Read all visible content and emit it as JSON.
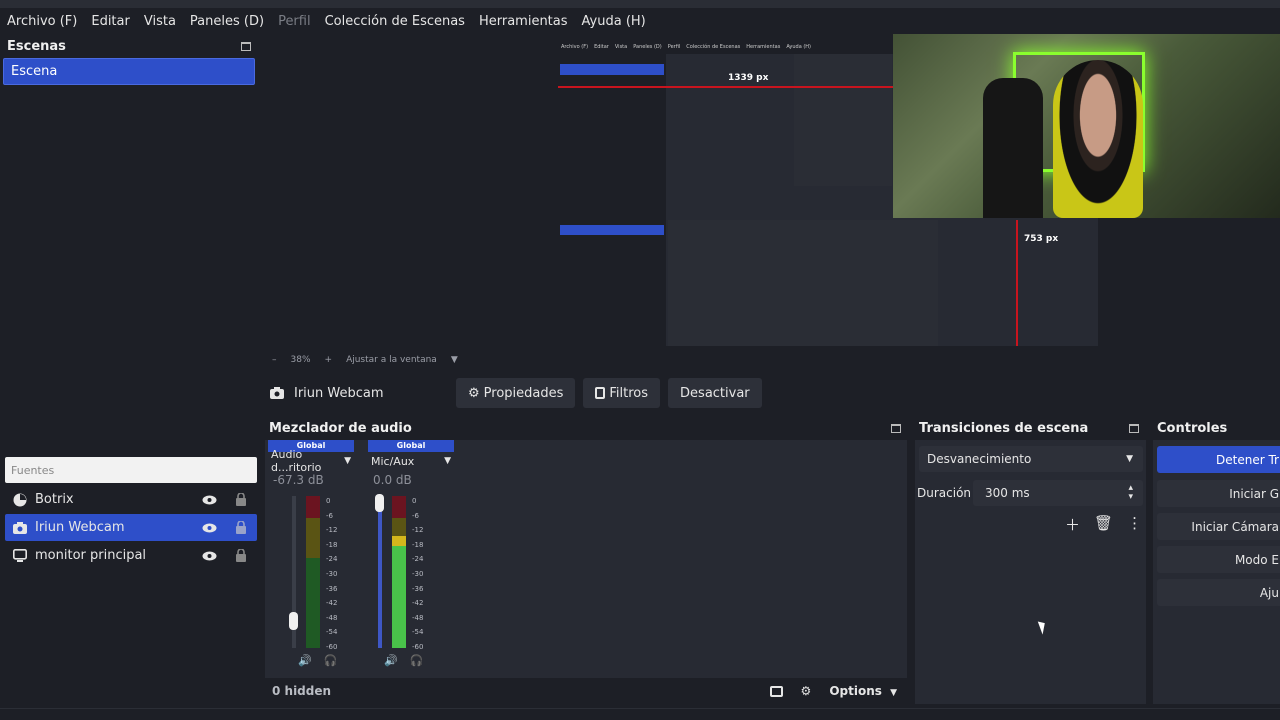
{
  "menu": [
    "Archivo (F)",
    "Editar",
    "Vista",
    "Paneles (D)",
    "Perfil",
    "Colección de Escenas",
    "Herramientas",
    "Ayuda (H)"
  ],
  "menu_disabled_index": 4,
  "scenes": {
    "title": "Escenas",
    "items": [
      "Escena"
    ]
  },
  "preview": {
    "width_label": "1339 px",
    "height_label": "753 px",
    "zoom": "38%",
    "fit_label": "Ajustar a la ventana"
  },
  "source_toolbar": {
    "source_name": "Iriun Webcam",
    "properties": "Propiedades",
    "filters": "Filtros",
    "deactivate": "Desactivar"
  },
  "sources": {
    "filter_placeholder": "Fuentes",
    "items": [
      {
        "name": "Botrix",
        "icon": "browser-icon"
      },
      {
        "name": "Iriun Webcam",
        "icon": "camera-icon"
      },
      {
        "name": "monitor principal",
        "icon": "monitor-icon"
      }
    ]
  },
  "mixer": {
    "title": "Mezclador de audio",
    "channels": [
      {
        "scope": "Global",
        "name": "Audio d...ritorio",
        "db": "-67.3 dB"
      },
      {
        "scope": "Global",
        "name": "Mic/Aux",
        "db": "0.0 dB"
      }
    ],
    "scale": [
      "0",
      "-6",
      "-12",
      "-18",
      "-24",
      "-30",
      "-36",
      "-42",
      "-48",
      "-54",
      "-60"
    ],
    "hidden": "0 hidden",
    "options": "Options"
  },
  "transitions": {
    "title": "Transiciones de escena",
    "selected": "Desvanecimiento",
    "duration_label": "Duración",
    "duration_value": "300 ms"
  },
  "controls": {
    "title": "Controles",
    "buttons": [
      "Detener Tr",
      "Iniciar G",
      "Iniciar Cámara",
      "Modo E",
      "Aju"
    ]
  },
  "colors": {
    "accent": "#2e4fc9",
    "bg": "#1d1f26",
    "panel": "#272a33",
    "red_line": "#c8141e"
  }
}
